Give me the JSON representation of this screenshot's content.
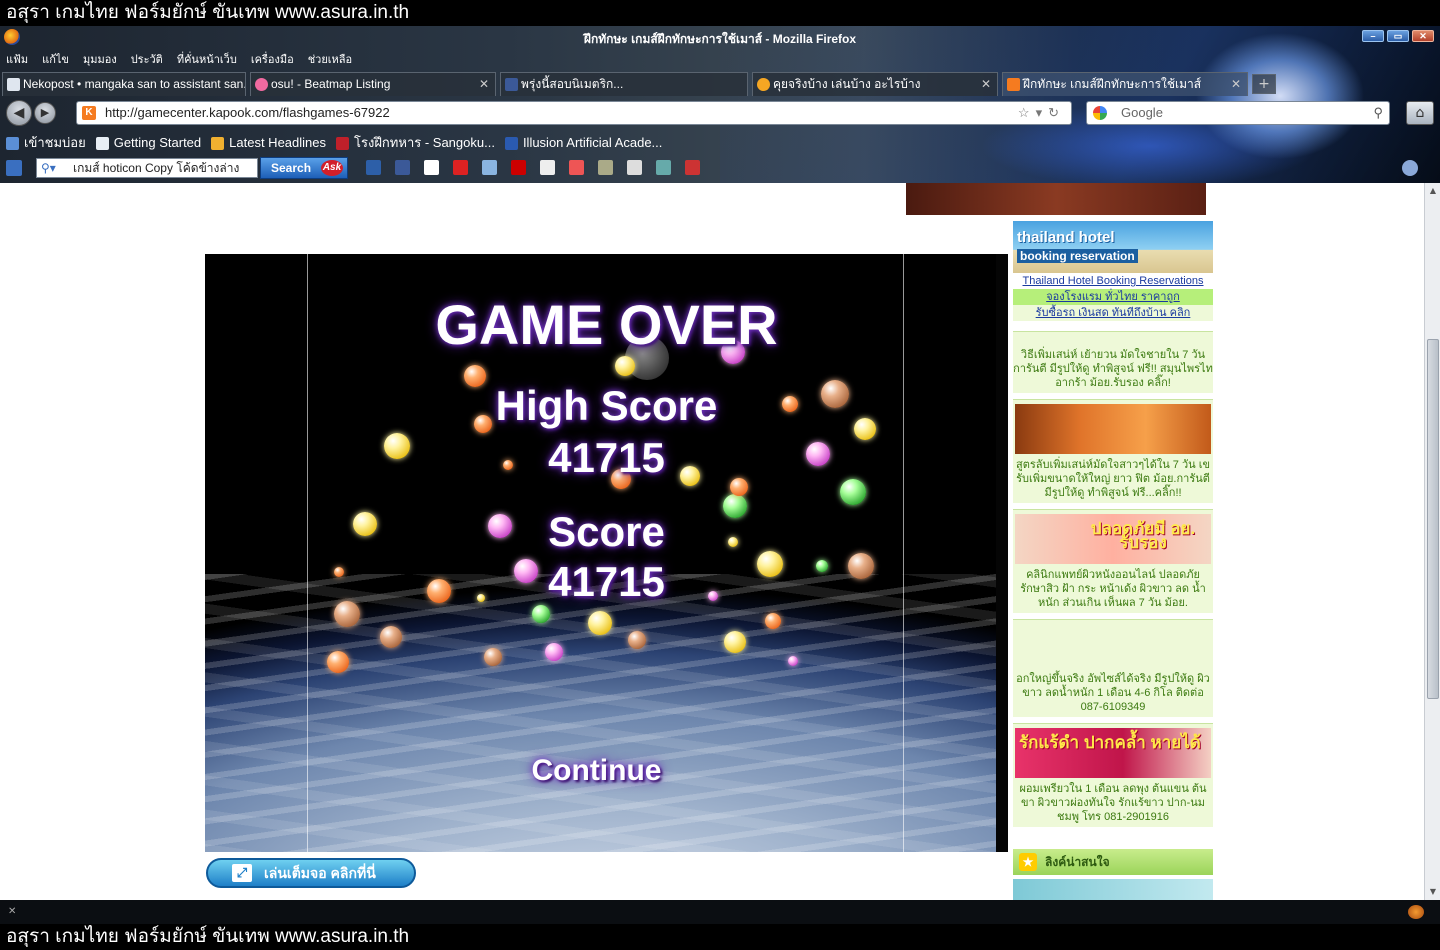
{
  "watermark": {
    "top_text": "อสุรา เกมไทย ฟอร์มยักษ์ ขันเทพ www.asura.in.th",
    "bottom_text": "อสุรา เกมไทย ฟอร์มยักษ์ ขันเทพ www.asura.in.th"
  },
  "window": {
    "title": "ฝึกทักษะ เกมส์ฝึกทักษะการใช้เมาส์ - Mozilla Firefox",
    "menu": [
      "แฟ้ม",
      "แก้ไข",
      "มุมมอง",
      "ประวัติ",
      "ที่คั่นหน้าเว็บ",
      "เครื่องมือ",
      "ช่วยเหลือ"
    ]
  },
  "tabs": [
    {
      "label": "Nekopost • mangaka san to assistant san...",
      "color": "#dfe6ef"
    },
    {
      "label": "osu! - Beatmap Listing",
      "color": "#f06aa0"
    },
    {
      "label": "พรุ่งนี้สอบนิเมตริก...",
      "color": "#3b5998"
    },
    {
      "label": "คุยจริงบ้าง เล่นบ้าง อะไรบ้าง",
      "color": "#f5a623"
    },
    {
      "label": "ฝึกทักษะ เกมส์ฝึกทักษะการใช้เมาส์",
      "color": "#f57b20"
    }
  ],
  "nav": {
    "url": "http://gamecenter.kapook.com/flashgames-67922",
    "search_placeholder": "Google",
    "k_favicon": "K"
  },
  "bookmarks": [
    {
      "label": "เข้าชมบ่อย",
      "color": "#5b8fd6"
    },
    {
      "label": "Getting Started",
      "color": "#e8eef5"
    },
    {
      "label": "Latest Headlines",
      "color": "#f0b030"
    },
    {
      "label": "โรงฝึกทหาร - Sangoku...",
      "color": "#c0202a"
    },
    {
      "label": "Illusion Artificial Acade...",
      "color": "#2a5ab0"
    }
  ],
  "toolbar2": {
    "ask_query": "เกมส์ hoticon Copy โค้ดข้างล่าง",
    "search_label": "Search",
    "ask_logo": "Ask"
  },
  "game": {
    "title": "GAME OVER",
    "high_score_label": "High Score",
    "high_score_value": "41715",
    "score_label": "Score",
    "score_value": "41715",
    "continue_label": "Continue"
  },
  "fullscreen_button": "เล่นเต็มจอ คลิกที่นี่",
  "sidebar": {
    "hotel_banner_line1": "thailand hotel",
    "hotel_banner_line2": "booking reservation",
    "links": [
      "Thailand Hotel Booking Reservations",
      "จองโรงแรม ทั่วไทย ราคาถูก",
      "รับซื้อรถ เงินสด ทันทีถึงบ้าน คลิก"
    ],
    "ads": [
      {
        "text": "วิธีเพิ่มเสน่ห์ เย้ายวน มัดใจชายใน 7 วัน การันตี มีรูปให้ดู ทำพิสูจน์ ฟรี!! สมุนไพรไท อากร้า ม้อย.รับรอง คลิ๊ก!",
        "image_label": ""
      },
      {
        "text": "สูตรลับเพิ่มเสน่ห์มัดใจสาวๆได้ใน 7 วัน เข รับเพิ่มขนาดให้ใหญ่ ยาว ฟิต ม้อย.การันตี มีรูปให้ดู ทำพิสูจน์ ฟรี...คลิ๊ก!!",
        "image_label": ""
      },
      {
        "text": "คลินิกแพทย์ผิวหนังออนไลน์ ปลอดภัย รักษาสิว ฝ้า กระ หน้าเด้ง ผิวขาว ลด น้ำหนัก ส่วนเกิน เห็นผล 7 วัน ม้อย.",
        "image_label": "ปลอดภัยมี อย. รับรอง"
      },
      {
        "text": "อกใหญ่ขึ้นจริง อัพไซส์ได้จริง มีรูปให้ดู ผิว ขาว ลดน้ำหนัก 1 เดือน 4-6 กิโล ติดต่อ 087-6109349",
        "image_label": ""
      },
      {
        "text": "ผอมเพรียวใน 1 เดือน ลดพุง ต้นแขน ต้นขา ผิวขาวผ่องทันใจ รักแร้ขาว ปาก-นมชมพู โทร 081-2901916",
        "image_label": "รักแร้ดำ ปากคล้ำ หายได้"
      }
    ],
    "section_title": "ลิงค์น่าสนใจ"
  }
}
